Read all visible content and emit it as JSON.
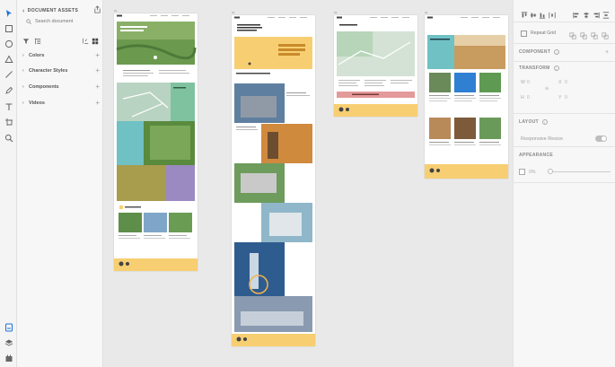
{
  "left_panel": {
    "title": "DOCUMENT ASSETS",
    "search_placeholder": "Search document",
    "sections": [
      {
        "label": "Colors"
      },
      {
        "label": "Character Styles"
      },
      {
        "label": "Components"
      },
      {
        "label": "Videos"
      }
    ]
  },
  "artboards": [
    {
      "label": "01"
    },
    {
      "label": "02"
    },
    {
      "label": "03"
    },
    {
      "label": "04"
    }
  ],
  "right_panel": {
    "repeat_grid_label": "Repeat Grid",
    "component_title": "COMPONENT",
    "transform_title": "TRANSFORM",
    "transform": {
      "w": "0",
      "x": "0",
      "h": "0",
      "y": "0"
    },
    "layout_title": "LAYOUT",
    "responsive_label": "Responsive Resize",
    "appearance_title": "APPEARANCE",
    "opacity_value": "0%"
  },
  "colors": {
    "accent_blue": "#1e6fd9",
    "yellow": "#f7cf72",
    "green": "#8cc5a5",
    "teal": "#6fc1c4",
    "purple": "#9a8ac1",
    "pink": "#e49a9a"
  }
}
